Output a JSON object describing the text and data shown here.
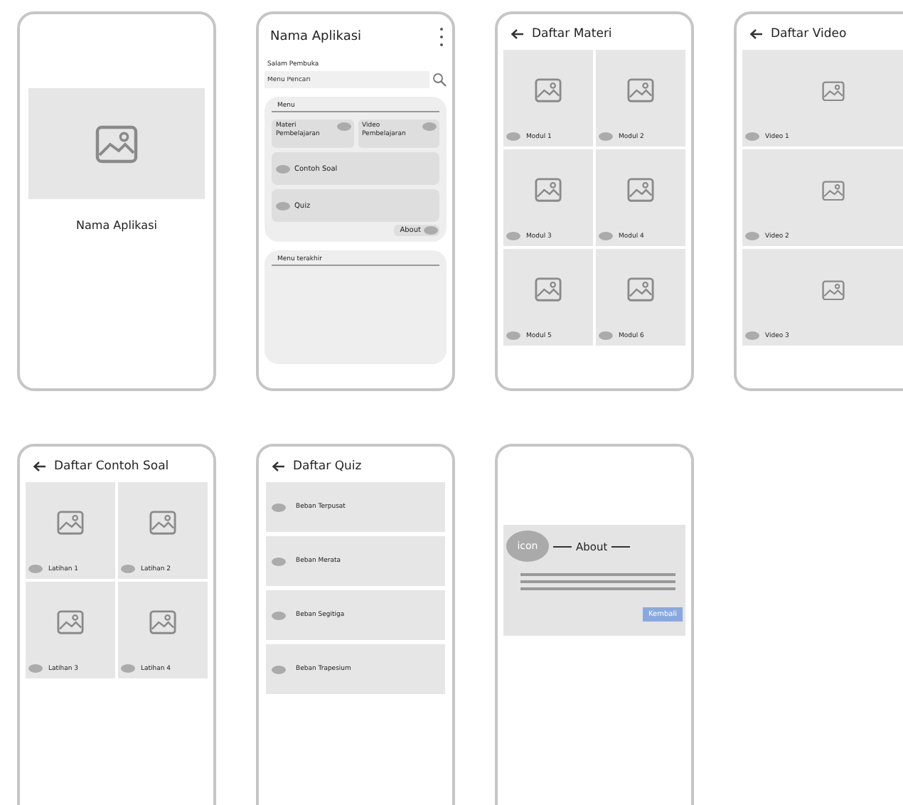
{
  "screens": [
    {
      "kind": "splash",
      "title": "Nama Aplikasi"
    },
    {
      "kind": "home",
      "title": "Nama Aplikasi",
      "greeting": "Salam Pembuka",
      "search": {
        "placeholder": "Menu Pencari"
      },
      "menu": {
        "heading": "Menu",
        "items": [
          {
            "kind": "tile",
            "label": "Materi Pembelajaran"
          },
          {
            "kind": "tile",
            "label": "Video Pembelajaran"
          },
          {
            "kind": "row",
            "label": "Contoh Soal"
          },
          {
            "kind": "row",
            "label": "Quiz"
          }
        ],
        "about": "About"
      },
      "recent": {
        "heading": "Menu terakhir"
      }
    },
    {
      "kind": "grid",
      "title": "Daftar Materi",
      "items": [
        "Modul 1",
        "Modul 2",
        "Modul 3",
        "Modul 4",
        "Modul 5",
        "Modul 6"
      ]
    },
    {
      "kind": "wide",
      "title": "Daftar Video",
      "items": [
        "Video 1",
        "Video 2",
        "Video 3"
      ]
    },
    {
      "kind": "grid",
      "title": "Daftar Contoh Soal",
      "items": [
        "Latihan 1",
        "Latihan 2",
        "Latihan 3",
        "Latihan 4"
      ]
    },
    {
      "kind": "list",
      "title": "Daftar Quiz",
      "items": [
        "Beban Terpusat",
        "Beban Merata",
        "Beban Segitiga",
        "Beban Trapesium"
      ]
    },
    {
      "kind": "about",
      "icon_label": "icon",
      "heading": "About",
      "button": "Kembali"
    }
  ]
}
